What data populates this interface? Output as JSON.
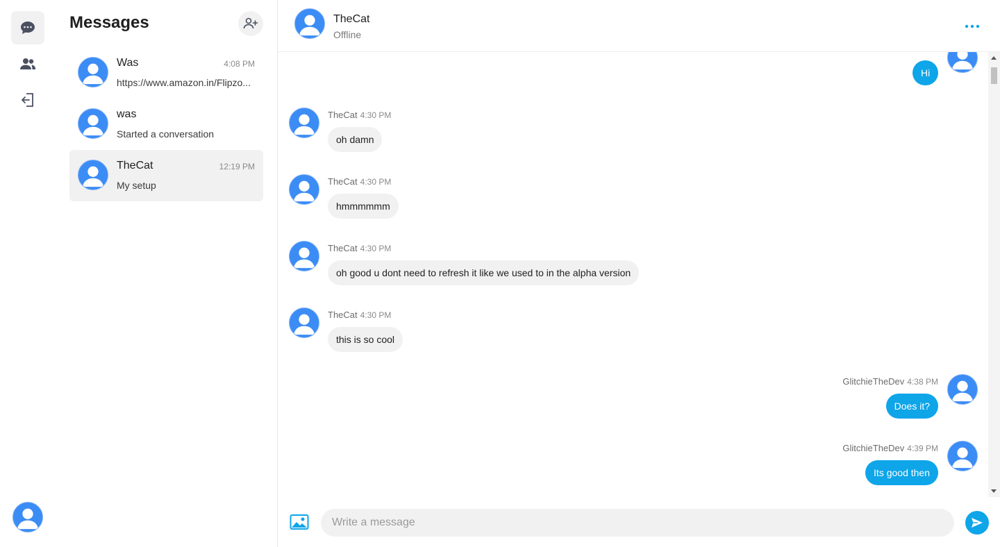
{
  "app": {
    "accent_color": "#0ea5e9",
    "avatar_color": "#3b8cf5"
  },
  "rail": {
    "items": [
      {
        "icon": "chat-bubble-icon",
        "active": true
      },
      {
        "icon": "users-icon",
        "active": false
      },
      {
        "icon": "logout-icon",
        "active": false
      }
    ],
    "user_avatar_icon": "user-avatar-icon"
  },
  "sidebar": {
    "title": "Messages",
    "new_chat_icon": "add-user-icon",
    "conversations": [
      {
        "name": "Was",
        "time": "4:08 PM",
        "preview": "https://www.amazon.in/Flipzo..."
      },
      {
        "name": "was",
        "time": "",
        "preview": "Started a conversation"
      },
      {
        "name": "TheCat",
        "time": "12:19 PM",
        "preview": "My setup"
      }
    ]
  },
  "chat": {
    "header": {
      "name": "TheCat",
      "status": "Offline",
      "more_icon": "more-dots-icon"
    },
    "messages": [
      {
        "direction": "out",
        "sender": "",
        "time": "",
        "text": "Hi"
      },
      {
        "direction": "in",
        "sender": "TheCat",
        "time": "4:30 PM",
        "text": "oh damn"
      },
      {
        "direction": "in",
        "sender": "TheCat",
        "time": "4:30 PM",
        "text": "hmmmmmm"
      },
      {
        "direction": "in",
        "sender": "TheCat",
        "time": "4:30 PM",
        "text": "oh good u dont need to refresh it like we used to in the alpha version"
      },
      {
        "direction": "in",
        "sender": "TheCat",
        "time": "4:30 PM",
        "text": "this is so cool"
      },
      {
        "direction": "out",
        "sender": "GlitchieTheDev",
        "time": "4:38 PM",
        "text": "Does it?"
      },
      {
        "direction": "out",
        "sender": "GlitchieTheDev",
        "time": "4:39 PM",
        "text": "Its good then"
      }
    ],
    "composer": {
      "placeholder": "Write a message",
      "value": "",
      "image_icon": "image-icon",
      "send_icon": "send-icon"
    }
  }
}
